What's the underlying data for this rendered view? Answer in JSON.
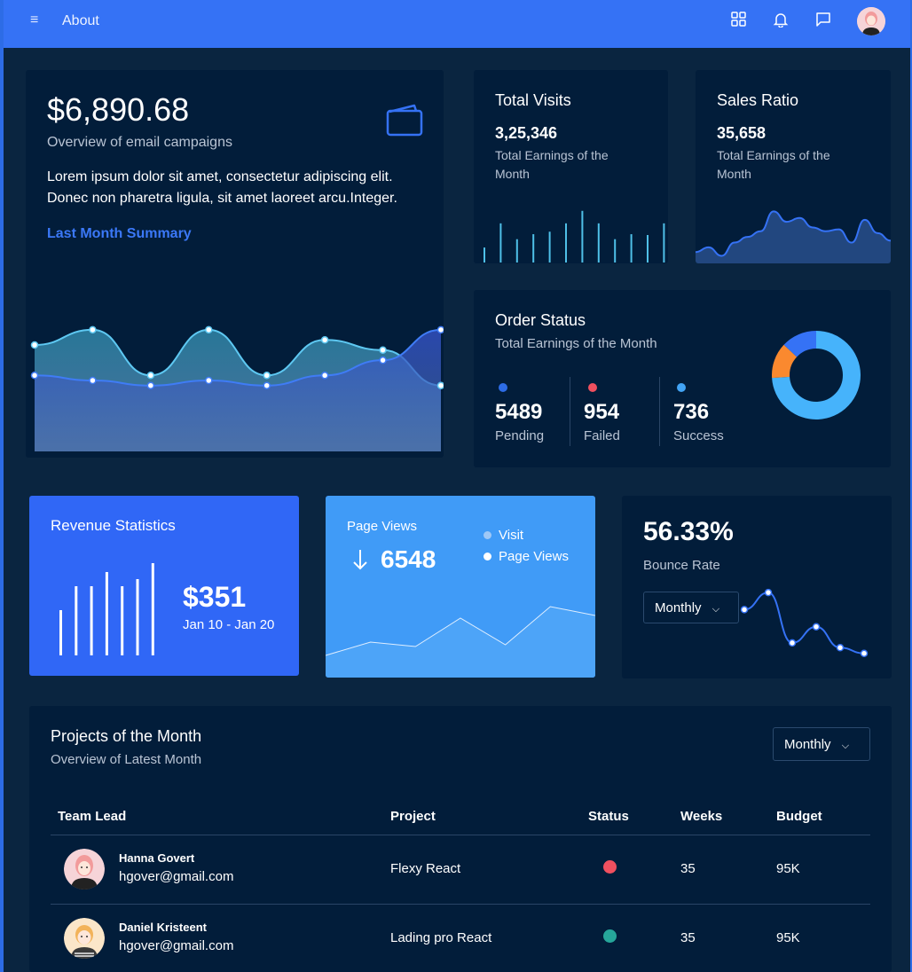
{
  "topbar": {
    "menu_icon": "hamburger-icon",
    "title": "About",
    "icons": [
      "grid-icon",
      "bell-icon",
      "chat-icon"
    ],
    "avatar": "user-avatar"
  },
  "overview": {
    "amount": "$6,890.68",
    "subtitle": "Overview of email campaigns",
    "text_line1": "Lorem ipsum dolor sit amet, consectetur adipiscing elit.",
    "text_line2": "Donec non pharetra ligula, sit amet laoreet arcu.Integer.",
    "link": "Last Month Summary",
    "icon": "wallet-icon",
    "chart_data": {
      "type": "area",
      "x": [
        1,
        2,
        3,
        4,
        5,
        6,
        7,
        8
      ],
      "series": [
        {
          "values": [
            21,
            24,
            15,
            24,
            15,
            22,
            20,
            13
          ]
        },
        {
          "values": [
            15,
            14,
            13,
            14,
            13,
            15,
            18,
            24
          ]
        }
      ]
    }
  },
  "total_visits": {
    "title": "Total Visits",
    "value": "3,25,346",
    "subtitle_line1": "Total Earnings of the",
    "subtitle_line2": "Month",
    "chart_data": {
      "type": "bar",
      "values": [
        18,
        47,
        28,
        34,
        37,
        47,
        62,
        47,
        28,
        34,
        33,
        47
      ]
    }
  },
  "sales_ratio": {
    "title": "Sales Ratio",
    "value": "35,658",
    "subtitle_line1": "Total Earnings of the",
    "subtitle_line2": "Month",
    "chart_data": {
      "type": "area",
      "values": [
        12,
        17,
        8,
        22,
        28,
        34,
        55,
        44,
        48,
        38,
        34,
        36,
        22,
        46,
        32,
        24
      ]
    }
  },
  "order_status": {
    "title": "Order Status",
    "subtitle": "Total Earnings of the Month",
    "items": [
      {
        "value": "5489",
        "label": "Pending",
        "color": "#2d6ce6"
      },
      {
        "value": "954",
        "label": "Failed",
        "color": "#f0505f"
      },
      {
        "value": "736",
        "label": "Success",
        "color": "#42a4f5"
      }
    ],
    "chart_data": {
      "type": "pie",
      "values": [
        74,
        13,
        13
      ],
      "colors": [
        "#46b3fb",
        "#fa892f",
        "#3572f5"
      ]
    }
  },
  "revenue": {
    "title": "Revenue Statistics",
    "amount": "$351",
    "range": "Jan 10 - Jan 20",
    "chart_data": {
      "type": "bar",
      "values": [
        51,
        78,
        78,
        94,
        78,
        86,
        104
      ]
    }
  },
  "page_views": {
    "title": "Page Views",
    "value": "6548",
    "arrow_icon": "arrow-down-icon",
    "legend": [
      {
        "label": "Visit",
        "color": "#9fc8f6"
      },
      {
        "label": "Page Views",
        "color": "#ffffff"
      }
    ],
    "chart_data": {
      "type": "line",
      "values": [
        5,
        20,
        15,
        47,
        17,
        60,
        50
      ]
    }
  },
  "bounce": {
    "value": "56.33%",
    "label": "Bounce Rate",
    "dropdown": "Monthly",
    "chart_data": {
      "type": "line",
      "values": [
        50,
        68,
        15,
        32,
        10,
        4
      ]
    }
  },
  "projects": {
    "title": "Projects of the Month",
    "subtitle": "Overview of Latest Month",
    "dropdown": "Monthly",
    "headers": [
      "Team Lead",
      "Project",
      "Status",
      "Weeks",
      "Budget"
    ],
    "rows": [
      {
        "name": "Hanna Govert",
        "email": "hgover@gmail.com",
        "project": "Flexy React",
        "status_color": "#f0505f",
        "weeks": "35",
        "budget": "95K"
      },
      {
        "name": "Daniel Kristeent",
        "email": "hgover@gmail.com",
        "project": "Lading pro React",
        "status_color": "#26a69a",
        "weeks": "35",
        "budget": "95K"
      }
    ]
  }
}
